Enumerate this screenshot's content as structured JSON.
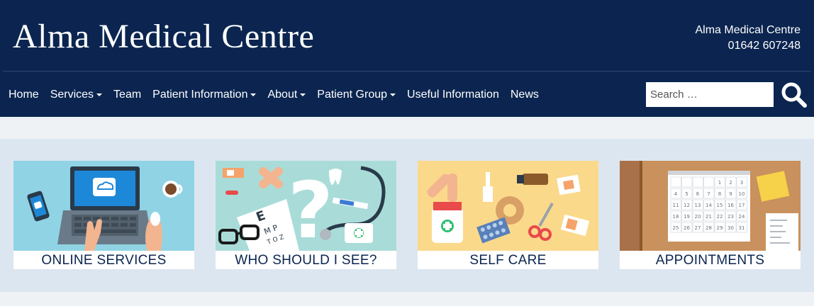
{
  "header": {
    "site_title": "Alma Medical Centre",
    "contact_name": "Alma Medical Centre",
    "contact_phone": "01642 607248"
  },
  "nav": {
    "items": [
      {
        "label": "Home",
        "dropdown": false
      },
      {
        "label": "Services",
        "dropdown": true
      },
      {
        "label": "Team",
        "dropdown": false
      },
      {
        "label": "Patient Information",
        "dropdown": true
      },
      {
        "label": "About",
        "dropdown": true
      },
      {
        "label": "Patient Group",
        "dropdown": true
      },
      {
        "label": "Useful Information",
        "dropdown": false
      },
      {
        "label": "News",
        "dropdown": false
      }
    ]
  },
  "search": {
    "placeholder": "Search …",
    "icon": "search-icon"
  },
  "tiles": [
    {
      "label": "ONLINE SERVICES",
      "bg": "#8fd3e4"
    },
    {
      "label": "WHO SHOULD I SEE?",
      "bg": "#a9dcd8"
    },
    {
      "label": "SELF CARE",
      "bg": "#fbd98b"
    },
    {
      "label": "APPOINTMENTS",
      "bg": "#c9915d"
    }
  ],
  "calendar": {
    "rows": [
      [
        "",
        "",
        "",
        "",
        "1",
        "2",
        "3"
      ],
      [
        "4",
        "5",
        "6",
        "7",
        "8",
        "9",
        "10"
      ],
      [
        "11",
        "12",
        "13",
        "14",
        "15",
        "16",
        "17"
      ],
      [
        "18",
        "19",
        "20",
        "21",
        "22",
        "23",
        "24"
      ],
      [
        "25",
        "26",
        "27",
        "28",
        "29",
        "30",
        "31"
      ]
    ]
  },
  "colors": {
    "header_bg": "#0b2550",
    "band_bg": "#dce6f0",
    "page_bg": "#eef2f5",
    "label_text": "#0b2550"
  }
}
